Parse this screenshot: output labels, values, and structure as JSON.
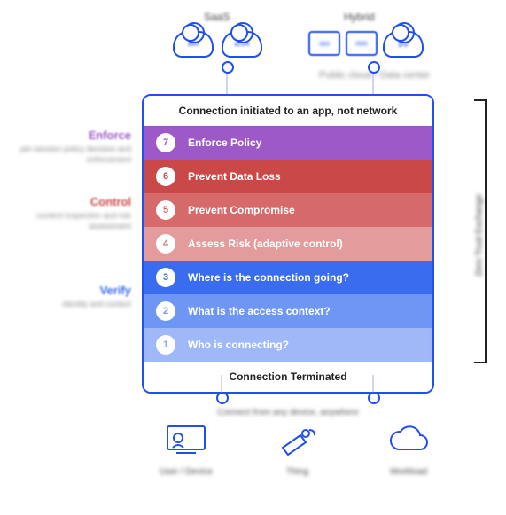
{
  "top_categories": {
    "saas": "SaaS",
    "hybrid": "Hybrid"
  },
  "top_icons": {
    "cloud1": "aws",
    "cloud2": "azure",
    "box1": "app",
    "box2": "data",
    "cloud3": "gcp",
    "hybrid_sub": "Public cloud / Data center"
  },
  "main": {
    "header": "Connection initiated to an app, not network",
    "rows": [
      {
        "n": "7",
        "label": "Enforce Policy"
      },
      {
        "n": "6",
        "label": "Prevent Data Loss"
      },
      {
        "n": "5",
        "label": "Prevent Compromise"
      },
      {
        "n": "4",
        "label": "Assess Risk (adaptive control)"
      },
      {
        "n": "3",
        "label": "Where is the connection going?"
      },
      {
        "n": "2",
        "label": "What is the access context?"
      },
      {
        "n": "1",
        "label": "Who is connecting?"
      }
    ],
    "footer": "Connection Terminated"
  },
  "left": {
    "enforce": {
      "title": "Enforce",
      "sub": "per-session policy decision and enforcement"
    },
    "control": {
      "title": "Control",
      "sub": "content inspection and risk assessment"
    },
    "verify": {
      "title": "Verify",
      "sub": "identity and context"
    }
  },
  "right_label": "Zero Trust Exchange",
  "bottom_note": "Connect from any device, anywhere",
  "bottom": {
    "user": "User / Device",
    "thing": "Thing",
    "workload": "Workload"
  }
}
